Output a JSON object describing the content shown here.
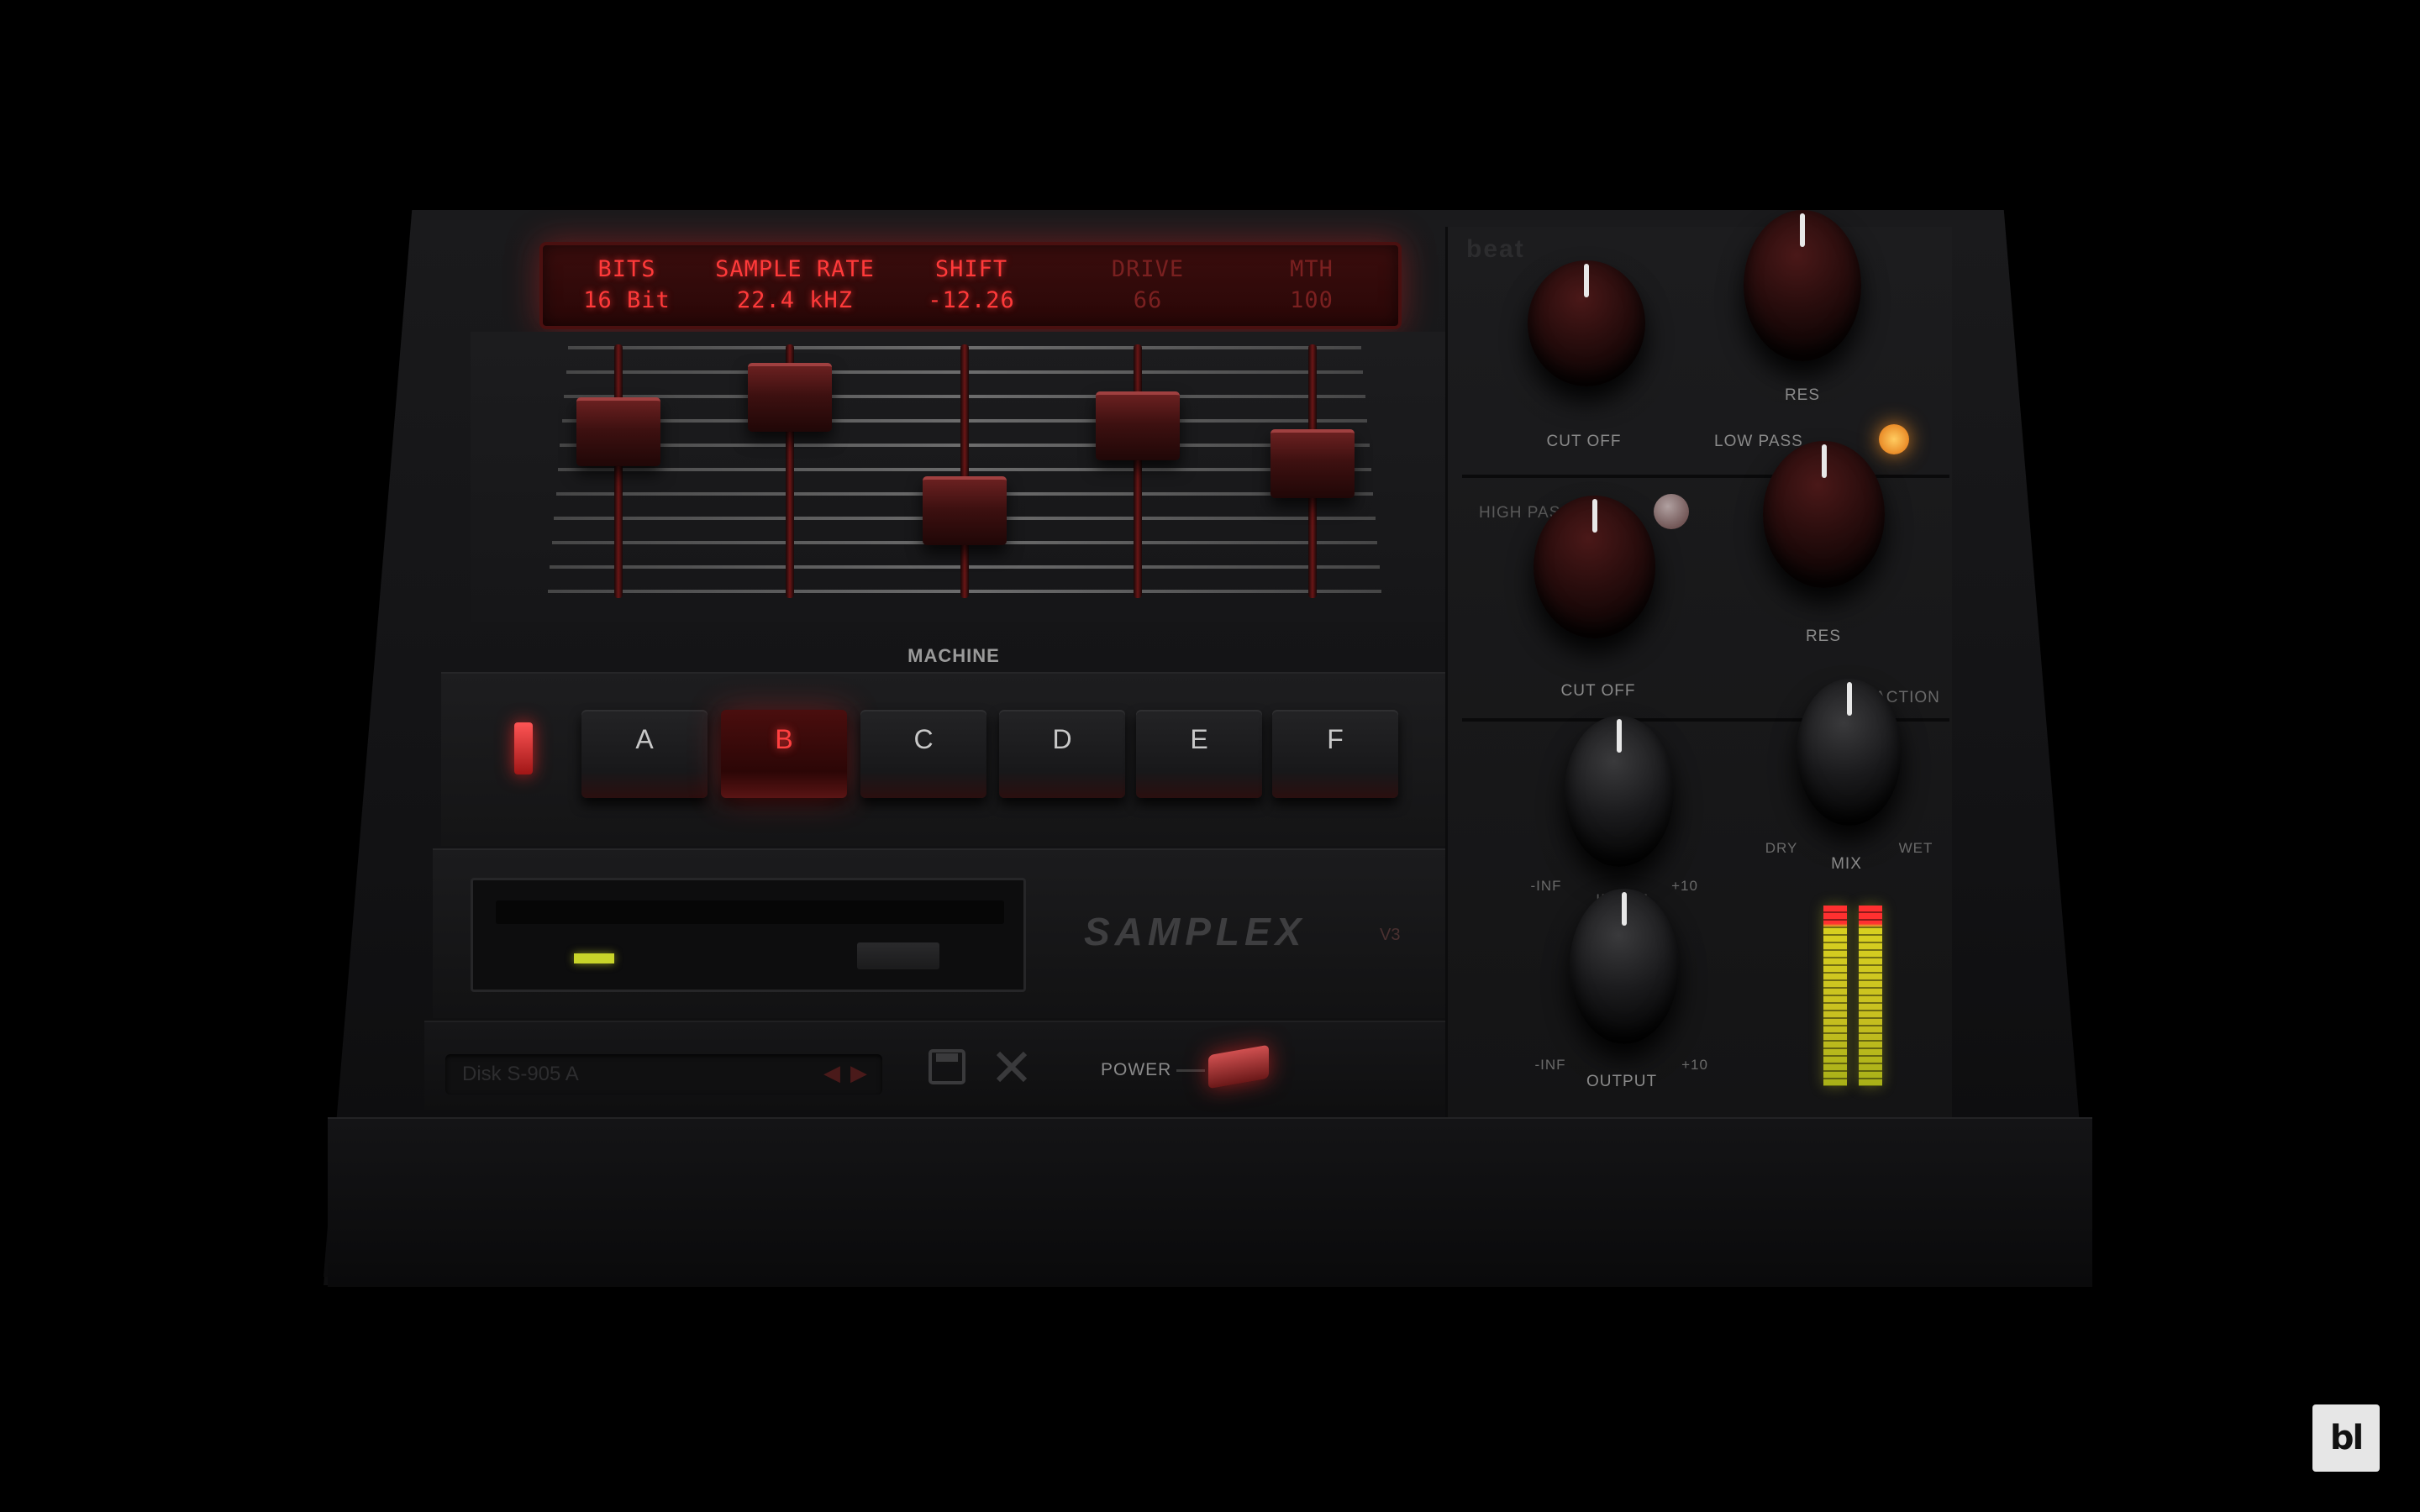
{
  "lcd": {
    "columns": [
      {
        "name": "BITS",
        "value": "16 Bit"
      },
      {
        "name": "SAMPLE RATE",
        "value": "22.4 kHZ"
      },
      {
        "name": "SHIFT",
        "value": "-12.26"
      },
      {
        "name": "DRIVE",
        "value": "66"
      },
      {
        "name": "MTH",
        "value": "100"
      }
    ]
  },
  "faders": [
    {
      "param": "bits",
      "level": 0.72
    },
    {
      "param": "sample-rate",
      "level": 0.9
    },
    {
      "param": "shift",
      "level": 0.3
    },
    {
      "param": "drive",
      "level": 0.75
    },
    {
      "param": "mth",
      "level": 0.55
    }
  ],
  "machine": {
    "label": "MACHINE",
    "buttons": [
      "A",
      "B",
      "C",
      "D",
      "E",
      "F"
    ],
    "selected": "B"
  },
  "brand": {
    "name": "SAMPLEX",
    "version": "V3",
    "maker": "beat"
  },
  "preset": {
    "name": "Disk S-905 A"
  },
  "power": {
    "label": "POWER"
  },
  "filters": {
    "low_pass_label": "LOW PASS",
    "high_pass_label": "HIGH PASS",
    "cut_off_label": "CUT OFF",
    "res_label": "RES",
    "section_label": "ACTION"
  },
  "mix": {
    "label": "MIX",
    "dry": "DRY",
    "wet": "WET"
  },
  "input": {
    "label": "INPUT",
    "min": "-INF",
    "max": "+10"
  },
  "output": {
    "label": "OUTPUT",
    "min": "-INF",
    "max": "+10"
  },
  "colors": {
    "accent": "#ff3a3a",
    "vu_green": "#c8c020",
    "led_orange": "#ffb040"
  },
  "corner_logo": "bl"
}
